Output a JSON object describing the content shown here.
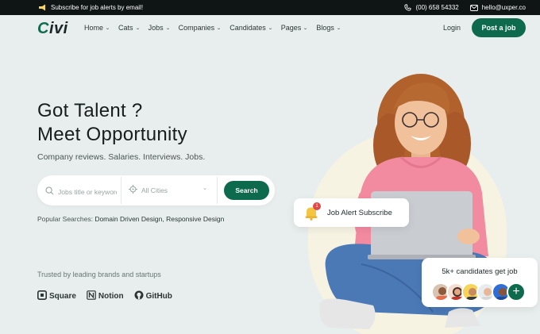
{
  "topbar": {
    "promo": "Subscribe for job alerts by email!",
    "phone": "(00) 658 54332",
    "email": "hello@uxper.co"
  },
  "brand": {
    "logo_c": "C",
    "logo_rest": "ivi"
  },
  "nav": {
    "items": [
      {
        "label": "Home"
      },
      {
        "label": "Cats"
      },
      {
        "label": "Jobs"
      },
      {
        "label": "Companies"
      },
      {
        "label": "Candidates"
      },
      {
        "label": "Pages"
      },
      {
        "label": "Blogs"
      }
    ],
    "login": "Login",
    "post_job": "Post a job"
  },
  "hero": {
    "title_line1": "Got Talent ?",
    "title_line2": "Meet Opportunity",
    "subtitle": "Company reviews. Salaries. Interviews. Jobs."
  },
  "search": {
    "keyword_placeholder": "Jobs title or keywords",
    "city_value": "All Cities",
    "button": "Search"
  },
  "popular": {
    "label": "Popular Searches:",
    "items": [
      "Domain Driven Design,",
      "Responsive Design"
    ]
  },
  "trusted": {
    "label": "Trusted by leading brands and startups",
    "brands": [
      "Square",
      "Notion",
      "GitHub"
    ]
  },
  "alert_card": {
    "label": "Job Alert Subscribe",
    "badge": "1"
  },
  "candidates_card": {
    "label": "5k+ candidates get job",
    "plus": "+"
  },
  "colors": {
    "accent": "#0e6a4c",
    "background": "#e8eeed",
    "topbar": "#0f1414",
    "badge": "#e04848"
  }
}
